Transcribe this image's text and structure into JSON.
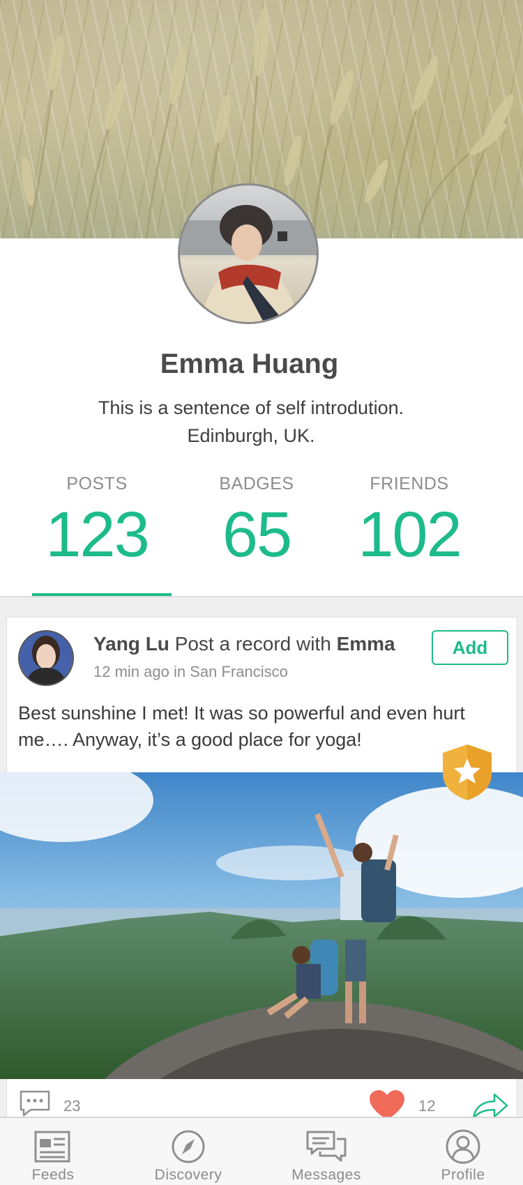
{
  "profile": {
    "name": "Emma Huang",
    "bio_line1": "This is a sentence of self introdution.",
    "bio_line2": "Edinburgh, UK.",
    "stats": [
      {
        "label": "POSTS",
        "value": "123"
      },
      {
        "label": "BADGES",
        "value": "65"
      },
      {
        "label": "FRIENDS",
        "value": "102"
      }
    ],
    "active_tab": "POSTS"
  },
  "post": {
    "author": "Yang Lu",
    "action": "Post a record with",
    "with_user": "Emma",
    "time": "12 min ago in San Francisco",
    "add_label": "Add",
    "text": "Best sunshine I met! It was so powerful and even hurt me…. Anyway, it’s a good place for yoga!",
    "comments": "23",
    "likes": "12"
  },
  "nav": {
    "items": [
      {
        "label": "Feeds",
        "icon": "newspaper-icon"
      },
      {
        "label": "Discovery",
        "icon": "compass-icon"
      },
      {
        "label": "Messages",
        "icon": "chat-bubbles-icon"
      },
      {
        "label": "Profile",
        "icon": "person-icon"
      }
    ]
  },
  "colors": {
    "accent": "#1dbb8a",
    "heart": "#f06b5a",
    "badge": "#f0b23c"
  }
}
